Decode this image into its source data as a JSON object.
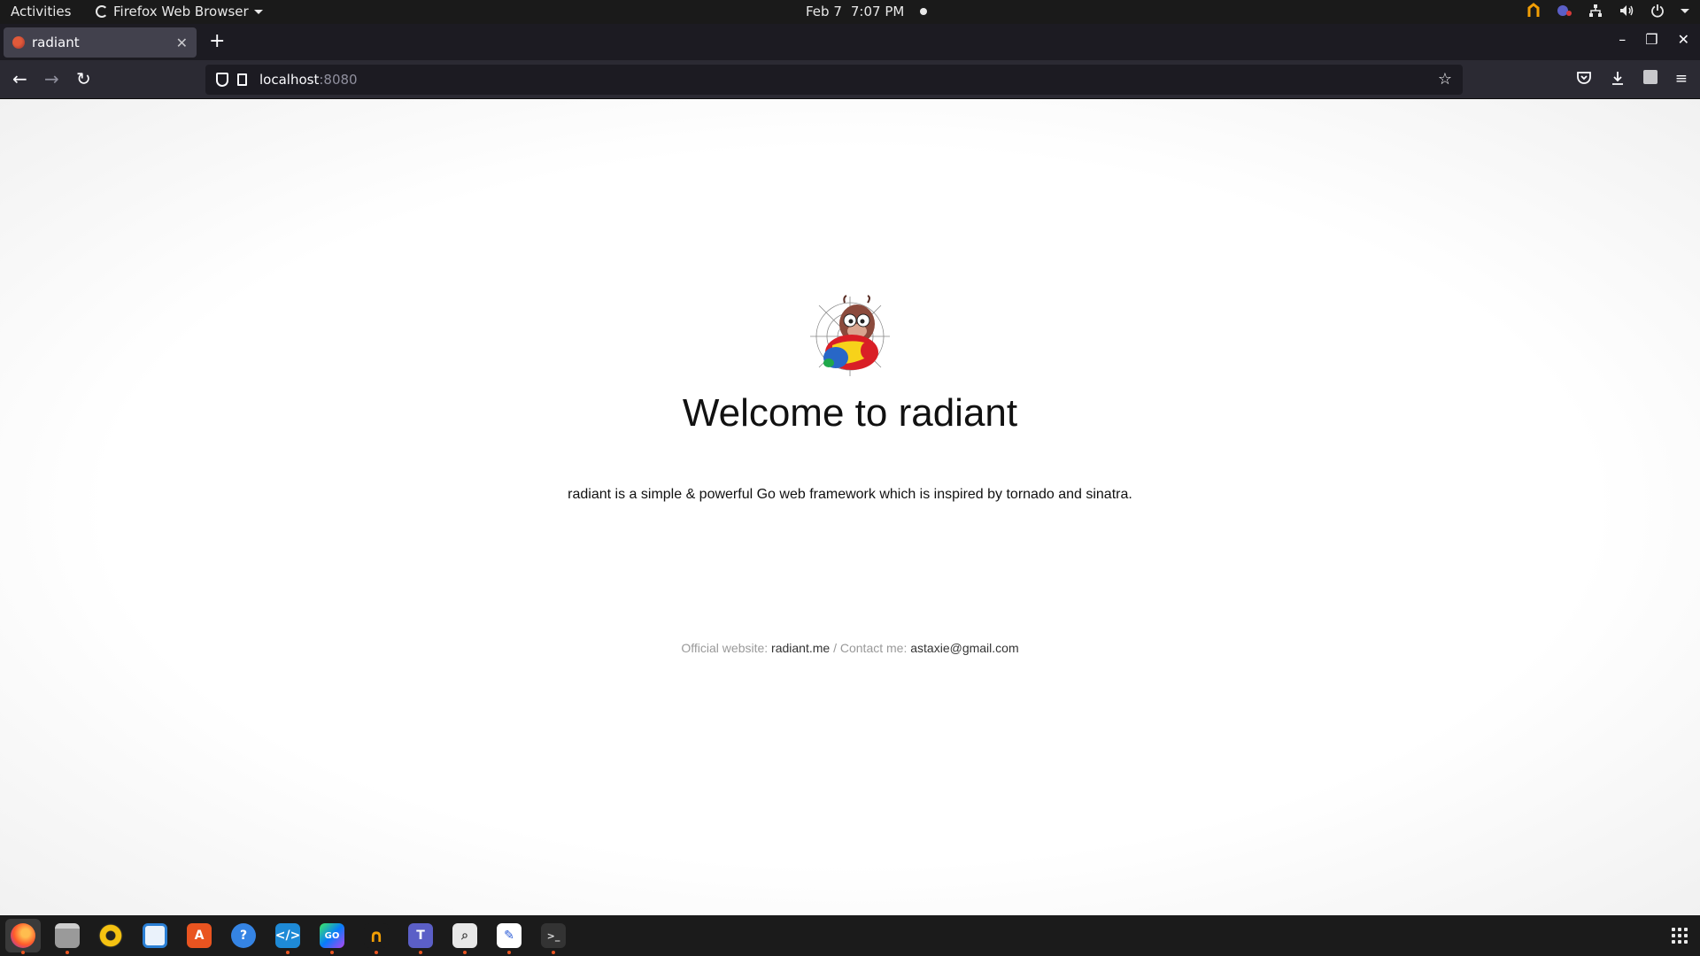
{
  "topbar": {
    "activities": "Activities",
    "app_name": "Firefox Web Browser",
    "date": "Feb 7",
    "time": "7:07 PM"
  },
  "browser": {
    "tab_title": "radiant",
    "url_host": "localhost",
    "url_port": ":8080"
  },
  "page": {
    "heading": "Welcome to radiant",
    "tagline": "radiant is a simple & powerful Go web framework which is inspired by tornado and sinatra.",
    "footer": {
      "website_label": "Official website: ",
      "website_link": "radiant.me",
      "separator": " / ",
      "contact_label": "Contact me: ",
      "contact_link": "astaxie@gmail.com"
    }
  },
  "dock": {
    "items": [
      {
        "icon": "firefox-icon",
        "color": "#e66000"
      },
      {
        "icon": "files-icon",
        "color": "#9a9a9a"
      },
      {
        "icon": "rhythmbox-icon",
        "color": "#f5c211"
      },
      {
        "icon": "writer-icon",
        "color": "#2a7fd4"
      },
      {
        "icon": "software-icon",
        "color": "#e95420"
      },
      {
        "icon": "help-icon",
        "color": "#3584e4"
      },
      {
        "icon": "vscode-icon",
        "color": "#1e8ad6"
      },
      {
        "icon": "goland-icon",
        "color": "#7d4dc9"
      },
      {
        "icon": "tracker-icon",
        "color": "#f29f05"
      },
      {
        "icon": "teams-icon",
        "color": "#5b5fc7"
      },
      {
        "icon": "image-viewer-icon",
        "color": "#bbbbbb"
      },
      {
        "icon": "text-editor-icon",
        "color": "#ffffff"
      },
      {
        "icon": "terminal-icon",
        "color": "#333333"
      }
    ]
  },
  "colors": {
    "accent": "#e95420",
    "browser_chrome": "#2b2a33",
    "page_bg": "#ffffff"
  }
}
